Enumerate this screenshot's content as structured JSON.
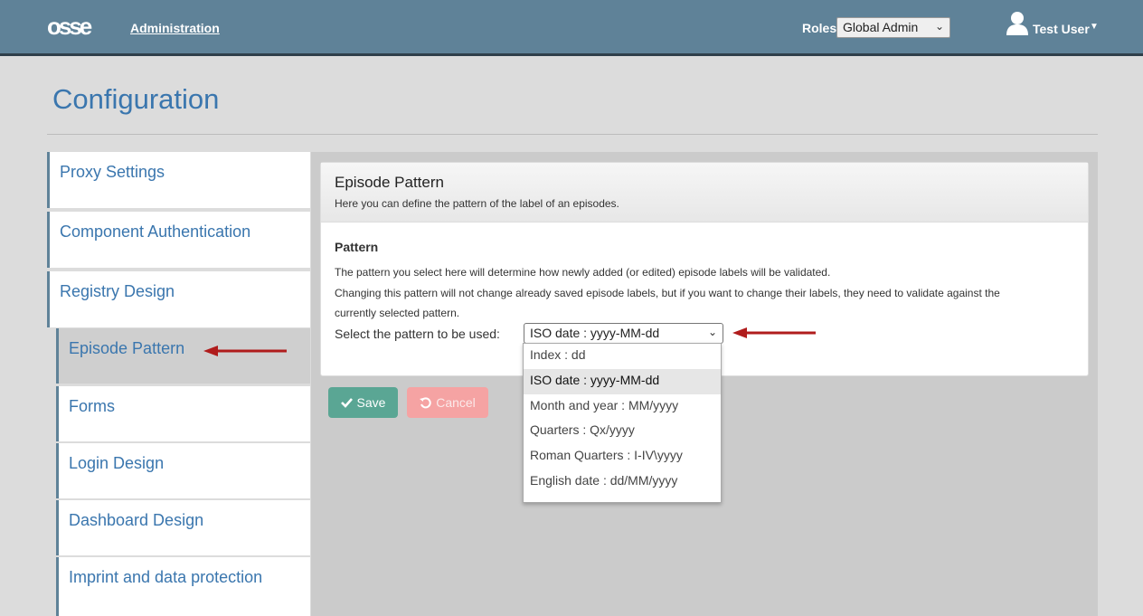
{
  "header": {
    "logo_text": "osse",
    "admin_link": "Administration",
    "roles_label": "Roles",
    "roles_selected": "Global Admin",
    "user_name": "Test User"
  },
  "page": {
    "title": "Configuration"
  },
  "sidebar": {
    "items": [
      {
        "label": "Proxy Settings",
        "active": false
      },
      {
        "label": "Component Authentication",
        "active": false
      },
      {
        "label": "Registry Design",
        "active": false
      },
      {
        "label": "Episode Pattern",
        "active": true
      },
      {
        "label": "Forms",
        "active": false
      },
      {
        "label": "Login Design",
        "active": false
      },
      {
        "label": "Dashboard Design",
        "active": false
      },
      {
        "label": "Imprint and data protection",
        "active": false
      }
    ]
  },
  "panel": {
    "title": "Episode Pattern",
    "subtitle": "Here you can define the pattern of the label of an episodes.",
    "section_title": "Pattern",
    "desc_line1": "The pattern you select here will determine how newly added (or edited) episode labels will be validated.",
    "desc_line2": "Changing this pattern will not change already saved episode labels, but if you want to change their labels, they need to validate against the",
    "desc_line3": "currently selected pattern.",
    "select_label": "Select the pattern to be used:",
    "selected_pattern": "ISO date : yyyy-MM-dd",
    "options": [
      "Index : dd",
      "ISO date : yyyy-MM-dd",
      "Month and year : MM/yyyy",
      "Quarters : Qx/yyyy",
      "Roman Quarters : I-IV\\yyyy",
      "English date : dd/MM/yyyy"
    ]
  },
  "buttons": {
    "save": "Save",
    "cancel": "Cancel"
  },
  "colors": {
    "header": "#5f8298",
    "link": "#3a76ae",
    "save": "#5aa694",
    "cancel": "#f5a3a3",
    "arrow": "#b01c1c"
  },
  "icons": {
    "save": "check-icon",
    "cancel": "undo-icon",
    "user": "user-icon"
  }
}
